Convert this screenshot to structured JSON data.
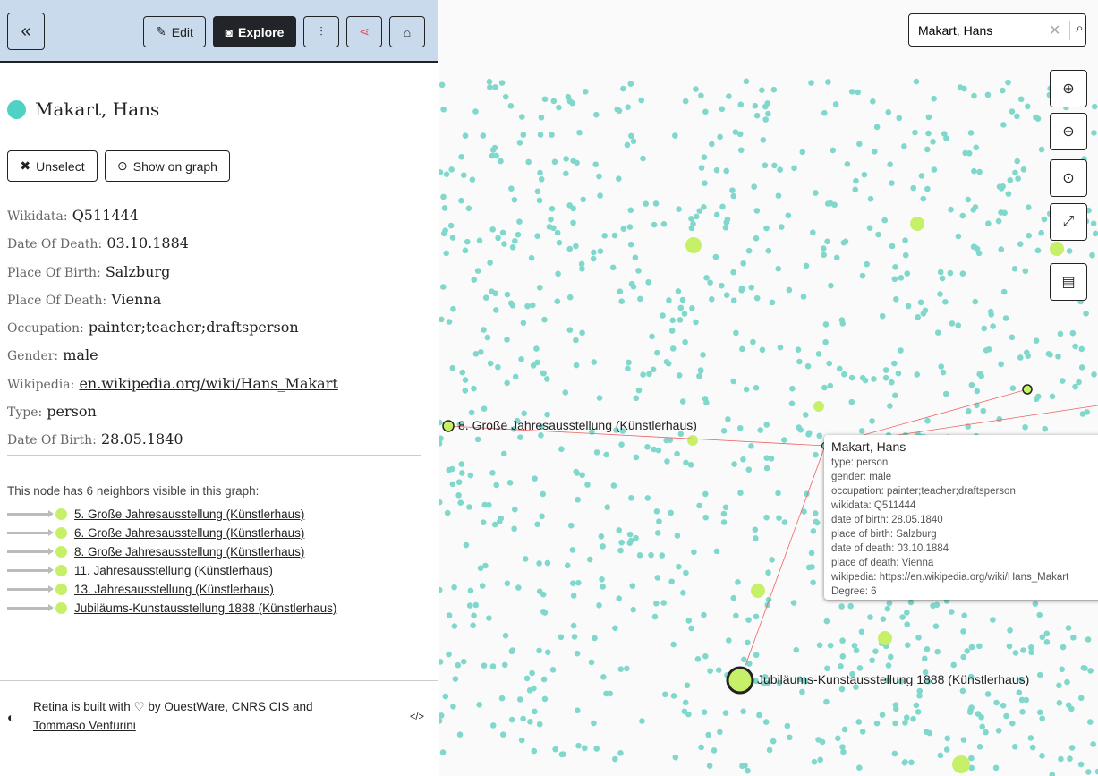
{
  "header": {
    "edit_label": "Edit",
    "explore_label": "Explore"
  },
  "node": {
    "title": "Makart, Hans",
    "color": "#4fd1c5",
    "unselect_label": "Unselect",
    "show_label": "Show on graph",
    "props": [
      {
        "key": "Wikidata:",
        "value": "Q511444"
      },
      {
        "key": "Date Of Death:",
        "value": "03.10.1884"
      },
      {
        "key": "Place Of Birth:",
        "value": "Salzburg"
      },
      {
        "key": "Place Of Death:",
        "value": "Vienna"
      },
      {
        "key": "Occupation:",
        "value": "painter;teacher;draftsperson"
      },
      {
        "key": "Gender:",
        "value": "male"
      },
      {
        "key": "Wikipedia:",
        "value": "en.wikipedia.org/wiki/Hans_Makart",
        "link": true
      },
      {
        "key": "Type:",
        "value": "person"
      },
      {
        "key": "Date Of Birth:",
        "value": "28.05.1840"
      }
    ],
    "neighbors_text": "This node has 6 neighbors visible in this graph:",
    "neighbors": [
      "5. Große Jahresausstellung (Künstlerhaus)",
      "6. Große Jahresausstellung (Künstlerhaus)",
      "8. Große Jahresausstellung (Künstlerhaus)",
      "11. Jahresausstellung (Künstlerhaus)",
      "13. Jahresausstellung (Künstlerhaus)",
      "Jubiläums-Kunstausstellung 1888 (Künstlerhaus)"
    ]
  },
  "footer": {
    "retina": "Retina",
    "built": " is built with ♡ by ",
    "ouest": "OuestWare",
    "cnrs": "CNRS CIS",
    "and": " and",
    "tommaso": "Tommaso Venturini"
  },
  "search": {
    "value": "Makart, Hans"
  },
  "graph": {
    "label_a": "8. Große Jahresausstellung (Künstlerhaus)",
    "label_b": "Jubiläums-Kunstausstellung 1888 (Künstlerhaus)",
    "person_color": "#80d8cc",
    "event_color": "#c6f068",
    "edge_color": "#f06060"
  },
  "tooltip": {
    "title": "Makart, Hans",
    "lines": [
      "type: person",
      "gender: male",
      "occupation: painter;teacher;draftsperson",
      "wikidata: Q511444",
      "date of birth: 28.05.1840",
      "place of birth: Salzburg",
      "date of death: 03.10.1884",
      "place of death: Vienna",
      "wikipedia: https://en.wikipedia.org/wiki/Hans_Makart",
      "Degree: 6"
    ]
  }
}
